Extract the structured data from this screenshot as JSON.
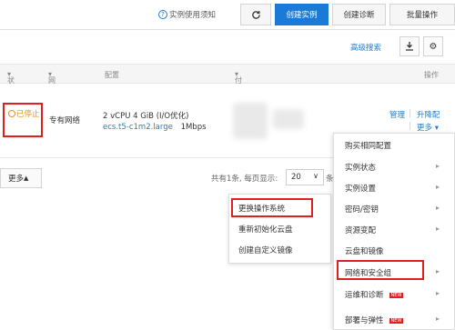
{
  "toolbar": {
    "help_icon": "question-circle",
    "help_label": "实例使用须知",
    "refresh_icon": "refresh",
    "create_instance": "创建实例",
    "create_diagnosis": "创建诊断",
    "batch_operations": "批量操作"
  },
  "search": {
    "advanced_search": "高级搜索",
    "icon_download": "download",
    "icon_settings": "gear"
  },
  "table": {
    "headers": [
      "状态",
      "网络类型",
      "配置",
      "付费方式",
      "操作"
    ],
    "row": {
      "status": "已停止",
      "network": "专有网络",
      "config_line1": "2 vCPU 4 GiB (I/O优化)",
      "config_type": "ecs.t5-c1m2.large",
      "config_bandwidth": "1Mbps",
      "action_manage": "管理",
      "action_upgrade": "升降配",
      "action_more": "更多"
    }
  },
  "footer": {
    "more_label": "更多",
    "pager_prefix": "共有1条, 每页显示:",
    "page_size": "20",
    "pager_suffix": "条"
  },
  "submenu": {
    "items": [
      "更换操作系统",
      "重新初始化云盘",
      "创建自定义镜像"
    ]
  },
  "right_menu": {
    "items": [
      {
        "label": "购买相同配置",
        "has_arrow": false,
        "tag": ""
      },
      {
        "label": "实例状态",
        "has_arrow": true,
        "tag": ""
      },
      {
        "label": "实例设置",
        "has_arrow": true,
        "tag": ""
      },
      {
        "label": "密码/密钥",
        "has_arrow": true,
        "tag": ""
      },
      {
        "label": "资源变配",
        "has_arrow": true,
        "tag": ""
      },
      {
        "label": "云盘和镜像",
        "has_arrow": false,
        "tag": ""
      },
      {
        "label": "网络和安全组",
        "has_arrow": true,
        "tag": ""
      },
      {
        "label": "运维和诊断",
        "has_arrow": true,
        "tag": "NEW"
      },
      {
        "label": "部署与弹性",
        "has_arrow": true,
        "tag": "NEW"
      }
    ]
  },
  "colors": {
    "primary": "#1b7ad8",
    "link": "#1f7fd1",
    "highlight_border": "#e0201f",
    "status_stopped": "#e8910b"
  }
}
